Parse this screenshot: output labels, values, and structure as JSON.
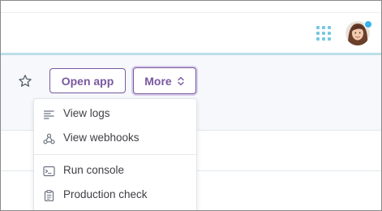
{
  "header": {
    "apps_icon": "grid-icon",
    "avatar_icon": "user-avatar",
    "notification_color": "#38b2e8"
  },
  "toolbar": {
    "favorite_icon": "star-icon",
    "open_app_label": "Open app",
    "more_label": "More",
    "more_icon": "chevron-up-down-icon"
  },
  "menu": {
    "items": [
      {
        "label": "View logs",
        "icon": "logs-icon"
      },
      {
        "label": "View webhooks",
        "icon": "webhooks-icon"
      },
      {
        "label": "Run console",
        "icon": "console-icon"
      },
      {
        "label": "Production check",
        "icon": "clipboard-icon"
      }
    ]
  },
  "colors": {
    "brand": "#79589f",
    "accent_line": "#bcdfe8",
    "grid_dots": "#79c8e0"
  }
}
